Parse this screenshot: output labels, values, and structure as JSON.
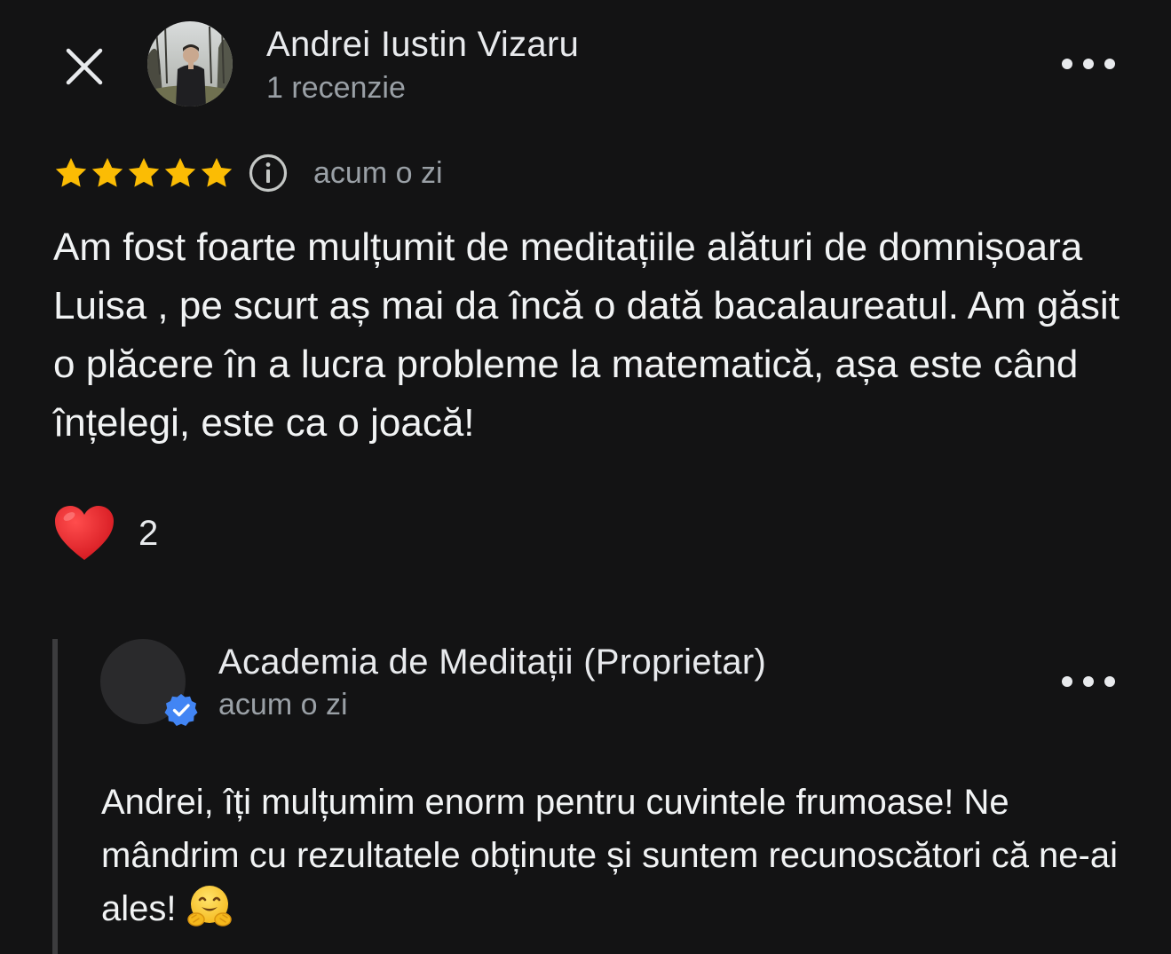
{
  "header": {
    "close_icon": "close-icon",
    "user_name": "Andrei Iustin Vizaru",
    "user_meta": "1 recenzie",
    "more_icon": "more-horizontal-icon"
  },
  "review": {
    "rating": 5,
    "rating_max": 5,
    "star_color": "#fbbc04",
    "info_icon": "info-icon",
    "time": "acum o zi",
    "text": "Am fost foarte mulțumit de meditațiile alături de domnișoara Luisa , pe scurt aș mai da încă o dată bacalaureatul. Am găsit o plăcere în a lucra probleme la matematică, așa este când înțelegi, este ca o joacă!",
    "reaction_icon": "heart-icon",
    "reaction_count": "2"
  },
  "reply": {
    "owner_name": "Academia de Meditații (Proprietar)",
    "time": "acum o zi",
    "verified_icon": "verified-badge-icon",
    "verified_color": "#4285f4",
    "text": "Andrei, îți mulțumim enorm pentru cuvintele frumoase! Ne mândrim cu rezultatele obținute și suntem recunoscători că ne-ai ales!",
    "emoji_icon": "hugging-face-emoji-icon"
  }
}
